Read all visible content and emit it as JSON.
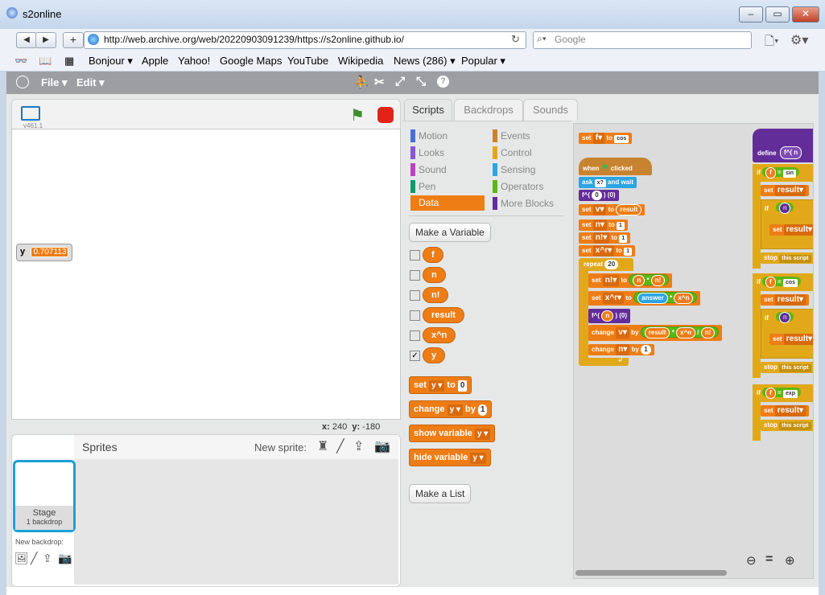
{
  "window": {
    "title": "s2online"
  },
  "browser": {
    "url": "http://web.archive.org/web/20220903091239/https://s2online.github.io/",
    "search_placeholder": "Google",
    "bookmarks": [
      "Bonjour ▾",
      "Apple",
      "Yahoo!",
      "Google Maps",
      "YouTube",
      "Wikipedia",
      "News (286) ▾",
      "Popular ▾"
    ]
  },
  "scratch": {
    "menu": {
      "file": "File ▾",
      "edit": "Edit ▾"
    },
    "version": "v461.1",
    "monitor": {
      "name": "y",
      "value": "0.707113"
    },
    "coords": {
      "x_label": "x:",
      "x": "240",
      "y_label": "y:",
      "y": "-180"
    },
    "sprites": {
      "title": "Sprites",
      "new_sprite": "New sprite:",
      "stage_label": "Stage",
      "stage_backdrops": "1 backdrop",
      "new_backdrop": "New backdrop:"
    },
    "tabs": [
      "Scripts",
      "Backdrops",
      "Sounds"
    ],
    "categories_left": [
      {
        "label": "Motion",
        "color": "#4a6cd4"
      },
      {
        "label": "Looks",
        "color": "#8a55d7"
      },
      {
        "label": "Sound",
        "color": "#bb42c3"
      },
      {
        "label": "Pen",
        "color": "#0e9a6c"
      },
      {
        "label": "Data",
        "color": "#ee7d16"
      }
    ],
    "categories_right": [
      {
        "label": "Events",
        "color": "#c88330"
      },
      {
        "label": "Control",
        "color": "#e1a91a"
      },
      {
        "label": "Sensing",
        "color": "#2ca5e2"
      },
      {
        "label": "Operators",
        "color": "#5cb712"
      },
      {
        "label": "More Blocks",
        "color": "#632d99"
      }
    ],
    "make_variable": "Make a Variable",
    "make_list": "Make a List",
    "variables": [
      {
        "name": "f",
        "checked": false
      },
      {
        "name": "n",
        "checked": false
      },
      {
        "name": "n!",
        "checked": false
      },
      {
        "name": "result",
        "checked": false
      },
      {
        "name": "x^n",
        "checked": false
      },
      {
        "name": "y",
        "checked": true
      }
    ],
    "palette_blocks": {
      "set": {
        "w1": "set",
        "var": "y",
        "w2": "to",
        "val": "0"
      },
      "change": {
        "w1": "change",
        "var": "y",
        "w2": "by",
        "val": "1"
      },
      "show": {
        "w1": "show variable",
        "var": "y"
      },
      "hide": {
        "w1": "hide variable",
        "var": "y"
      }
    },
    "script": {
      "set_top": {
        "w1": "set",
        "var": "f",
        "w2": "to",
        "val": "cos"
      },
      "hat": {
        "w1": "when",
        "w2": "clicked"
      },
      "ask": {
        "w1": "ask",
        "val": "x?",
        "w2": "and wait"
      },
      "call1": {
        "w1": "f^(",
        "val": "0",
        "w2": ") (0)"
      },
      "set_v_result": {
        "w1": "set",
        "var": "v",
        "w2": "to",
        "val": "result"
      },
      "set_n_1": {
        "w1": "set",
        "var": "n",
        "w2": "to",
        "val": "1"
      },
      "set_nf_1": {
        "w1": "set",
        "var": "n!",
        "w2": "to",
        "val": "1"
      },
      "set_xn_1": {
        "w1": "set",
        "var": "x^r",
        "w2": "to",
        "val": "1"
      },
      "repeat": {
        "w1": "repeat",
        "val": "20"
      },
      "inner_set_nf": {
        "w1": "set",
        "var": "n!",
        "w2": "to",
        "a": "n",
        "op": "*",
        "b": "n!"
      },
      "inner_set_xn": {
        "w1": "set",
        "var": "x^r",
        "w2": "to",
        "a": "answer",
        "op": "*",
        "b": "x^n"
      },
      "inner_call": {
        "w1": "f^(",
        "val": "n",
        "w2": ") (0)"
      },
      "inner_change_v": {
        "w1": "change",
        "var": "v",
        "w2": "by",
        "a": "result",
        "op": "*",
        "b": "x^n",
        "op2": "/",
        "c": "n!"
      },
      "inner_change_n": {
        "w1": "change",
        "var": "n",
        "w2": "by",
        "val": "1"
      },
      "define": {
        "w1": "define",
        "w2": "f^(",
        "val": "n"
      },
      "if_a": {
        "w1": "if",
        "f": "f",
        "op": "=",
        "val": "sin"
      },
      "set_result": {
        "w1": "set",
        "var": "result"
      },
      "stop": {
        "w1": "stop",
        "val": "this script"
      },
      "if_b": {
        "w1": "if",
        "f": "f",
        "op": "=",
        "val": "cos"
      },
      "if_c": {
        "w1": "if",
        "f": "f",
        "op": "=",
        "val": "exp"
      },
      "if_inner": {
        "w1": "if",
        "val": "n"
      },
      "set_short": {
        "w1": "set",
        "var": "result"
      }
    }
  }
}
